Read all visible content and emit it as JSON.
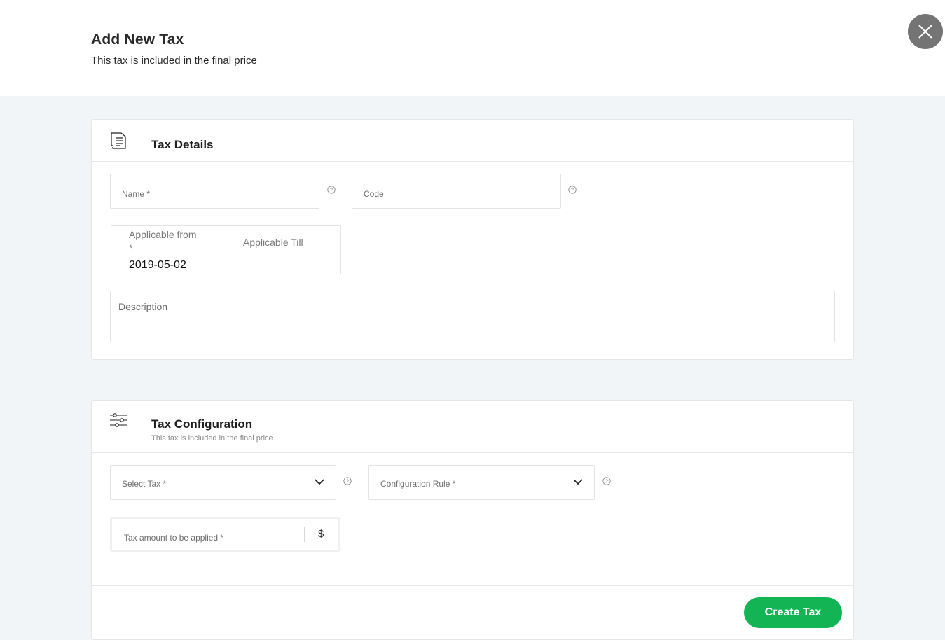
{
  "header": {
    "title": "Add New Tax",
    "subtitle": "This tax is included in the final price"
  },
  "details": {
    "title": "Tax Details",
    "name_placeholder": "Name *",
    "code_placeholder": "Code",
    "applicable_from_label_line1": "Applicable from",
    "applicable_from_label_line2": "*",
    "applicable_from_value": "2019-05-02",
    "applicable_till_label": "Applicable Till",
    "description_placeholder": "Description"
  },
  "config": {
    "title": "Tax Configuration",
    "subtitle": "This tax is included in the final price",
    "select_tax_placeholder": "Select Tax *",
    "config_rule_placeholder": "Configuration Rule *",
    "amount_placeholder": "Tax amount to be applied *",
    "currency_symbol": "$"
  },
  "actions": {
    "create_label": "Create Tax"
  },
  "colors": {
    "primary": "#12b454",
    "close_bg": "#747474",
    "page_bg": "#f2f5f8"
  },
  "icons": {
    "close": "close-icon",
    "details": "document-list-icon",
    "config": "sliders-icon",
    "help": "help-circle-icon",
    "dropdown": "chevron-down-icon"
  }
}
